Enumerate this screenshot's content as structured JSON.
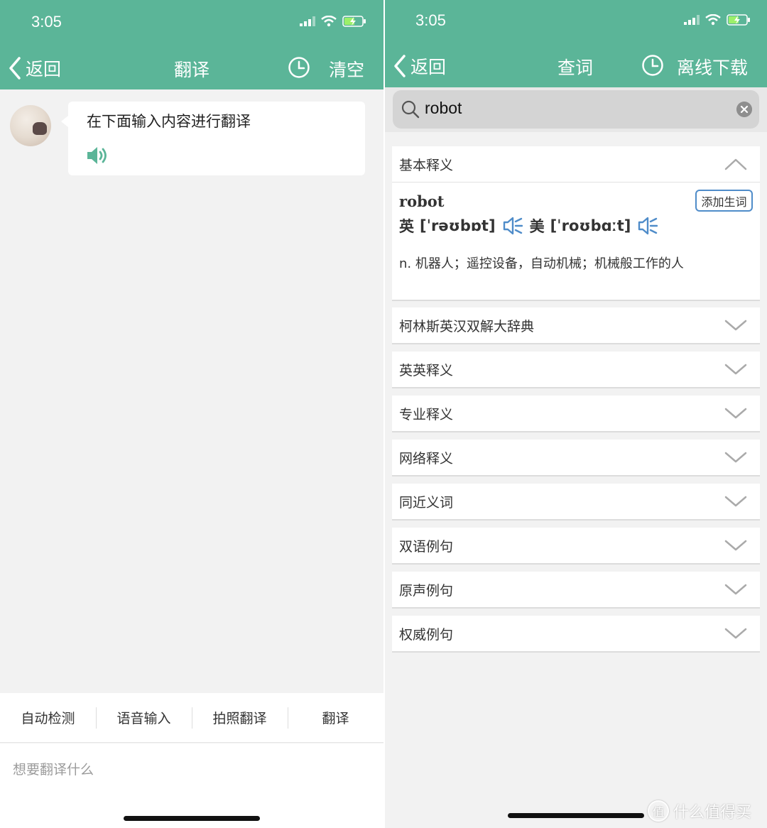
{
  "colors": {
    "brand": "#5bb598",
    "link_blue": "#4f8cc9",
    "background": "#f2f2f2"
  },
  "left": {
    "status_time": "3:05",
    "back_label": "返回",
    "title": "翻译",
    "clear_label": "清空",
    "bubble_text": "在下面输入内容进行翻译",
    "bottom_tabs": [
      "自动检测",
      "语音输入",
      "拍照翻译",
      "翻译"
    ],
    "input_placeholder": "想要翻译什么"
  },
  "right": {
    "status_time": "3:05",
    "back_label": "返回",
    "title": "查词",
    "offline_label": "离线下载",
    "search_value": "robot",
    "basic": {
      "label": "基本释义",
      "word": "robot",
      "add_label": "添加生词",
      "uk_label": "英",
      "uk_phonetic": "[ˈrəʊbɒt]",
      "us_label": "美",
      "us_phonetic": "[ˈroʊbɑːt]",
      "definition": "n. 机器人；遥控设备，自动机械；机械般工作的人"
    },
    "sections": [
      "柯林斯英汉双解大辞典",
      "英英释义",
      "专业释义",
      "网络释义",
      "同近义词",
      "双语例句",
      "原声例句",
      "权威例句"
    ]
  },
  "watermark": {
    "badge": "值",
    "text": "什么值得买"
  }
}
